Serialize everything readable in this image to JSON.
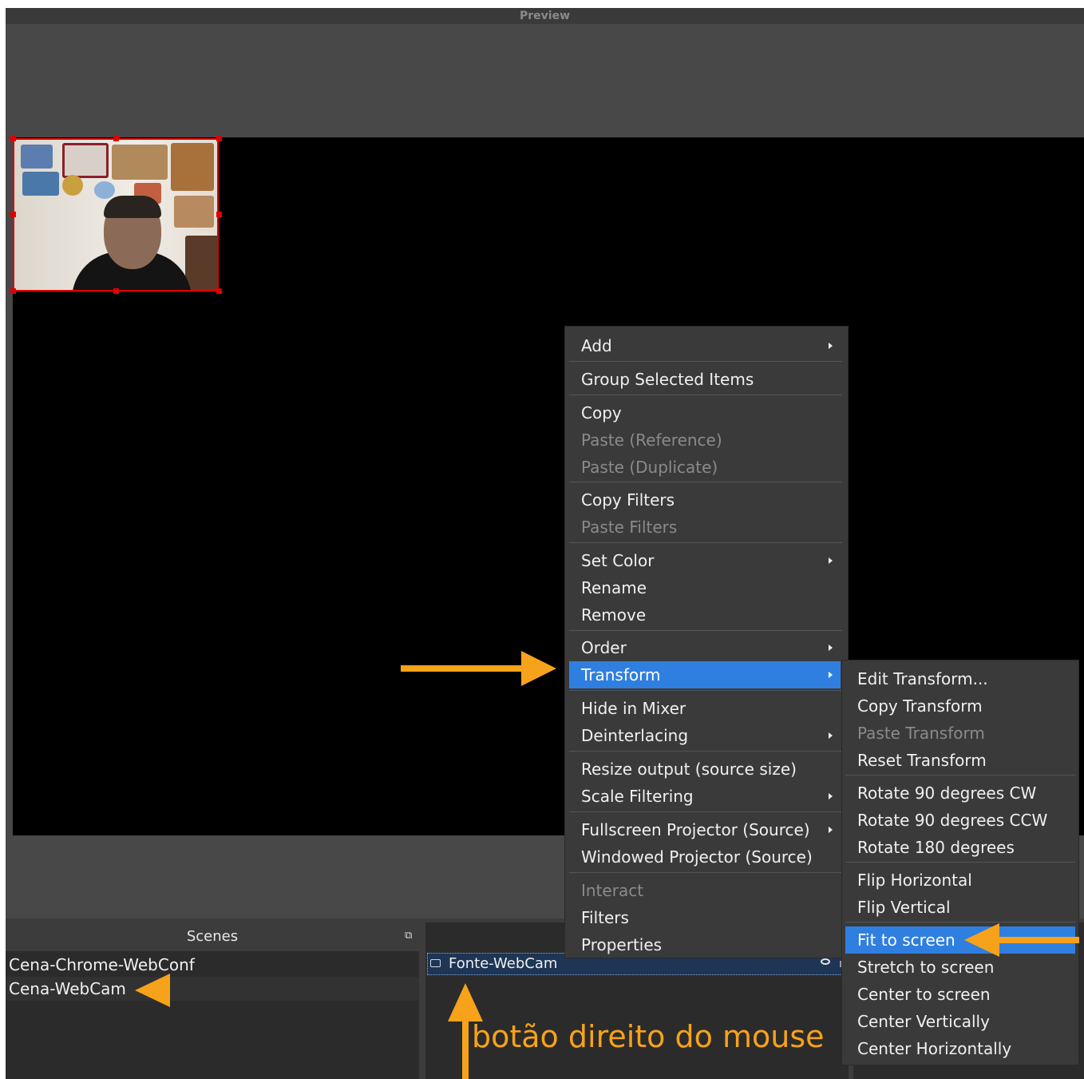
{
  "preview": {
    "title": "Preview"
  },
  "scenes": {
    "title": "Scenes",
    "items": [
      "Cena-Chrome-WebConf",
      "Cena-WebCam"
    ]
  },
  "sources": {
    "items": [
      "Fonte-WebCam"
    ]
  },
  "context_menu": {
    "items": [
      "Add",
      "Group Selected Items",
      "Copy",
      "Paste (Reference)",
      "Paste (Duplicate)",
      "Copy Filters",
      "Paste Filters",
      "Set Color",
      "Rename",
      "Remove",
      "Order",
      "Transform",
      "Hide in Mixer",
      "Deinterlacing",
      "Resize output (source size)",
      "Scale Filtering",
      "Fullscreen Projector (Source)",
      "Windowed Projector (Source)",
      "Interact",
      "Filters",
      "Properties"
    ],
    "active": "Transform"
  },
  "transform_menu": {
    "items": [
      "Edit Transform...",
      "Copy Transform",
      "Paste Transform",
      "Reset Transform",
      "Rotate 90 degrees CW",
      "Rotate 90 degrees CCW",
      "Rotate 180 degrees",
      "Flip Horizontal",
      "Flip Vertical",
      "Fit to screen",
      "Stretch to screen",
      "Center to screen",
      "Center Vertically",
      "Center Horizontally"
    ],
    "active": "Fit to screen"
  },
  "annotation": {
    "text": "botão direito do mouse",
    "color": "#f7a21b"
  },
  "colors": {
    "accent": "#2f7fe0",
    "selection_border": "#e00000"
  }
}
